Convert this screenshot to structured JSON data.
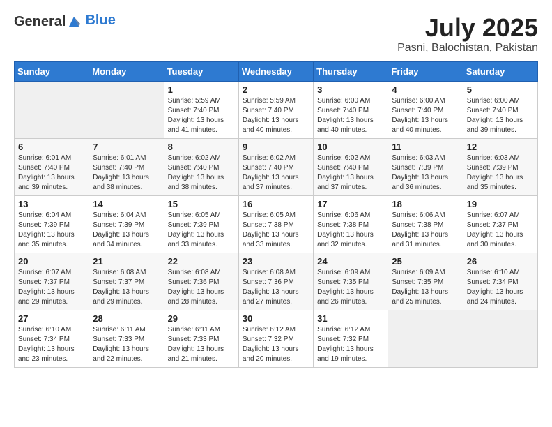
{
  "header": {
    "logo_general": "General",
    "logo_blue": "Blue",
    "title": "July 2025",
    "subtitle": "Pasni, Balochistan, Pakistan"
  },
  "days_of_week": [
    "Sunday",
    "Monday",
    "Tuesday",
    "Wednesday",
    "Thursday",
    "Friday",
    "Saturday"
  ],
  "weeks": [
    [
      {
        "day": "",
        "info": ""
      },
      {
        "day": "",
        "info": ""
      },
      {
        "day": "1",
        "info": "Sunrise: 5:59 AM\nSunset: 7:40 PM\nDaylight: 13 hours and 41 minutes."
      },
      {
        "day": "2",
        "info": "Sunrise: 5:59 AM\nSunset: 7:40 PM\nDaylight: 13 hours and 40 minutes."
      },
      {
        "day": "3",
        "info": "Sunrise: 6:00 AM\nSunset: 7:40 PM\nDaylight: 13 hours and 40 minutes."
      },
      {
        "day": "4",
        "info": "Sunrise: 6:00 AM\nSunset: 7:40 PM\nDaylight: 13 hours and 40 minutes."
      },
      {
        "day": "5",
        "info": "Sunrise: 6:00 AM\nSunset: 7:40 PM\nDaylight: 13 hours and 39 minutes."
      }
    ],
    [
      {
        "day": "6",
        "info": "Sunrise: 6:01 AM\nSunset: 7:40 PM\nDaylight: 13 hours and 39 minutes."
      },
      {
        "day": "7",
        "info": "Sunrise: 6:01 AM\nSunset: 7:40 PM\nDaylight: 13 hours and 38 minutes."
      },
      {
        "day": "8",
        "info": "Sunrise: 6:02 AM\nSunset: 7:40 PM\nDaylight: 13 hours and 38 minutes."
      },
      {
        "day": "9",
        "info": "Sunrise: 6:02 AM\nSunset: 7:40 PM\nDaylight: 13 hours and 37 minutes."
      },
      {
        "day": "10",
        "info": "Sunrise: 6:02 AM\nSunset: 7:40 PM\nDaylight: 13 hours and 37 minutes."
      },
      {
        "day": "11",
        "info": "Sunrise: 6:03 AM\nSunset: 7:39 PM\nDaylight: 13 hours and 36 minutes."
      },
      {
        "day": "12",
        "info": "Sunrise: 6:03 AM\nSunset: 7:39 PM\nDaylight: 13 hours and 35 minutes."
      }
    ],
    [
      {
        "day": "13",
        "info": "Sunrise: 6:04 AM\nSunset: 7:39 PM\nDaylight: 13 hours and 35 minutes."
      },
      {
        "day": "14",
        "info": "Sunrise: 6:04 AM\nSunset: 7:39 PM\nDaylight: 13 hours and 34 minutes."
      },
      {
        "day": "15",
        "info": "Sunrise: 6:05 AM\nSunset: 7:39 PM\nDaylight: 13 hours and 33 minutes."
      },
      {
        "day": "16",
        "info": "Sunrise: 6:05 AM\nSunset: 7:38 PM\nDaylight: 13 hours and 33 minutes."
      },
      {
        "day": "17",
        "info": "Sunrise: 6:06 AM\nSunset: 7:38 PM\nDaylight: 13 hours and 32 minutes."
      },
      {
        "day": "18",
        "info": "Sunrise: 6:06 AM\nSunset: 7:38 PM\nDaylight: 13 hours and 31 minutes."
      },
      {
        "day": "19",
        "info": "Sunrise: 6:07 AM\nSunset: 7:37 PM\nDaylight: 13 hours and 30 minutes."
      }
    ],
    [
      {
        "day": "20",
        "info": "Sunrise: 6:07 AM\nSunset: 7:37 PM\nDaylight: 13 hours and 29 minutes."
      },
      {
        "day": "21",
        "info": "Sunrise: 6:08 AM\nSunset: 7:37 PM\nDaylight: 13 hours and 29 minutes."
      },
      {
        "day": "22",
        "info": "Sunrise: 6:08 AM\nSunset: 7:36 PM\nDaylight: 13 hours and 28 minutes."
      },
      {
        "day": "23",
        "info": "Sunrise: 6:08 AM\nSunset: 7:36 PM\nDaylight: 13 hours and 27 minutes."
      },
      {
        "day": "24",
        "info": "Sunrise: 6:09 AM\nSunset: 7:35 PM\nDaylight: 13 hours and 26 minutes."
      },
      {
        "day": "25",
        "info": "Sunrise: 6:09 AM\nSunset: 7:35 PM\nDaylight: 13 hours and 25 minutes."
      },
      {
        "day": "26",
        "info": "Sunrise: 6:10 AM\nSunset: 7:34 PM\nDaylight: 13 hours and 24 minutes."
      }
    ],
    [
      {
        "day": "27",
        "info": "Sunrise: 6:10 AM\nSunset: 7:34 PM\nDaylight: 13 hours and 23 minutes."
      },
      {
        "day": "28",
        "info": "Sunrise: 6:11 AM\nSunset: 7:33 PM\nDaylight: 13 hours and 22 minutes."
      },
      {
        "day": "29",
        "info": "Sunrise: 6:11 AM\nSunset: 7:33 PM\nDaylight: 13 hours and 21 minutes."
      },
      {
        "day": "30",
        "info": "Sunrise: 6:12 AM\nSunset: 7:32 PM\nDaylight: 13 hours and 20 minutes."
      },
      {
        "day": "31",
        "info": "Sunrise: 6:12 AM\nSunset: 7:32 PM\nDaylight: 13 hours and 19 minutes."
      },
      {
        "day": "",
        "info": ""
      },
      {
        "day": "",
        "info": ""
      }
    ]
  ]
}
